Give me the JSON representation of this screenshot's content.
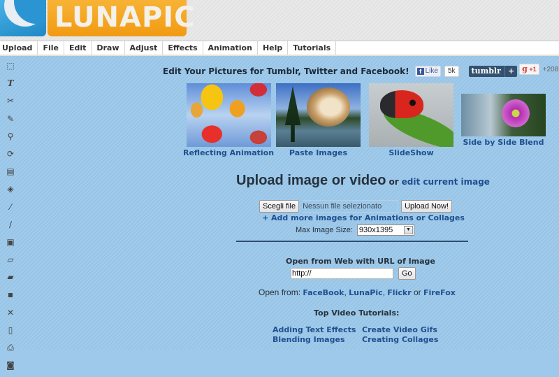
{
  "brand": {
    "logo_text": "LUNAPIC",
    "colors": {
      "logo_orange": "#f29a12",
      "logo_blue": "#1f88c6",
      "page_bg": "#9ec9ea",
      "link": "#1f4f8f"
    }
  },
  "menu": [
    "Upload",
    "File",
    "Edit",
    "Draw",
    "Adjust",
    "Effects",
    "Animation",
    "Help",
    "Tutorials"
  ],
  "toolbar": [
    {
      "name": "select-icon",
      "glyph": "⬚"
    },
    {
      "name": "text-icon",
      "glyph": "T"
    },
    {
      "name": "scissors-icon",
      "glyph": "✂"
    },
    {
      "name": "pencil-icon",
      "glyph": "✎"
    },
    {
      "name": "zoom-icon",
      "glyph": "⚲"
    },
    {
      "name": "rotate-icon",
      "glyph": "⟳"
    },
    {
      "name": "gradient-icon",
      "glyph": "▤"
    },
    {
      "name": "paint-bucket-icon",
      "glyph": "◈"
    },
    {
      "name": "eyedropper-icon",
      "glyph": "⁄"
    },
    {
      "name": "brush-icon",
      "glyph": "∕"
    },
    {
      "name": "layers-icon",
      "glyph": "▣"
    },
    {
      "name": "eraser-icon",
      "glyph": "▱"
    },
    {
      "name": "open-folder-icon",
      "glyph": "▰"
    },
    {
      "name": "save-icon",
      "glyph": "▪"
    },
    {
      "name": "close-icon",
      "glyph": "✕"
    },
    {
      "name": "document-icon",
      "glyph": "▯"
    },
    {
      "name": "print-icon",
      "glyph": "⎙"
    },
    {
      "name": "camera-icon",
      "glyph": "◙"
    }
  ],
  "tagline": "Edit Your Pictures for Tumblr, Twitter and Facebook!",
  "social": {
    "fb_label": "Like",
    "fb_count": "5k",
    "tumblr_label": "tumblr",
    "tumblr_plus": "+",
    "gplus_label": "+1",
    "gplus_count": "+208"
  },
  "features": [
    {
      "caption": "Reflecting Animation"
    },
    {
      "caption": "Paste Images"
    },
    {
      "caption": "SlideShow"
    },
    {
      "caption": "Side by Side Blend"
    }
  ],
  "upload": {
    "title": "Upload image or video",
    "or": "or",
    "edit_link": "edit current image",
    "choose_file": "Scegli file",
    "file_status": "Nessun file selezionato",
    "upload_now": "Upload Now!",
    "add_more": "+ Add more images for Animations or Collages",
    "max_size_label": "Max Image Size:",
    "max_size_value": "930x1395"
  },
  "url": {
    "title": "Open from Web with URL of Image",
    "value": "http://",
    "go": "Go"
  },
  "open_from": {
    "label": "Open from:",
    "links": [
      "FaceBook",
      "LunaPic",
      "Flickr",
      "FireFox"
    ],
    "sep1": ",",
    "sep2": ",",
    "or": "or"
  },
  "tutorials": {
    "title": "Top Video Tutorials:",
    "links": [
      "Adding Text Effects",
      "Create Video Gifs",
      "Blending Images",
      "Creating Collages"
    ]
  }
}
